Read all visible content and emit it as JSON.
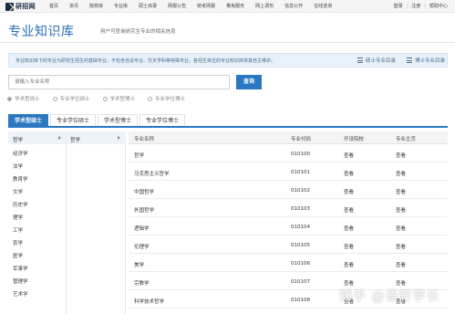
{
  "header": {
    "logo_text": "研招网",
    "nav": [
      "首页",
      "资讯",
      "院校库",
      "专业库",
      "硕士目录",
      "网报公告",
      "统考网报",
      "推免服务",
      "网上调剂",
      "信息公开",
      "在线咨询"
    ],
    "login": "登录",
    "register": "注册",
    "help": "帮助中心"
  },
  "page": {
    "title": "专业知识库",
    "subtitle": "用户可查询研究生专业的相关信息"
  },
  "info": {
    "text": "专业知识库下的专业为研究生招生的基础专业，不包含自设专业、交叉学科等特殊专业，各招生单位的专业知识库将其自主维护。",
    "link_master": "硕士专业目录",
    "link_doctor": "博士专业目录"
  },
  "search": {
    "placeholder": "请输入专业名称",
    "button": "查询"
  },
  "radios": [
    {
      "label": "学术型硕士",
      "checked": true
    },
    {
      "label": "专业学位硕士",
      "checked": false
    },
    {
      "label": "学术型博士",
      "checked": false
    },
    {
      "label": "专业学位博士",
      "checked": false
    }
  ],
  "tabs": [
    "学术型硕士",
    "专业学位硕士",
    "学术型博士",
    "专业学位博士"
  ],
  "categories": [
    "哲学",
    "经济学",
    "法学",
    "教育学",
    "文学",
    "历史学",
    "理学",
    "工学",
    "农学",
    "医学",
    "军事学",
    "管理学",
    "艺术学"
  ],
  "subcategory": "哲学",
  "table": {
    "headers": [
      "专业名称",
      "专业代码",
      "开设院校",
      "专业主页"
    ],
    "rows": [
      {
        "name": "哲学",
        "code": "010100",
        "school": "查看",
        "home": "查看"
      },
      {
        "name": "马克思主义哲学",
        "code": "010101",
        "school": "查看",
        "home": "查看"
      },
      {
        "name": "中国哲学",
        "code": "010102",
        "school": "查看",
        "home": "查看"
      },
      {
        "name": "外国哲学",
        "code": "010103",
        "school": "查看",
        "home": "查看"
      },
      {
        "name": "逻辑学",
        "code": "010104",
        "school": "查看",
        "home": "查看"
      },
      {
        "name": "伦理学",
        "code": "010105",
        "school": "查看",
        "home": "查看"
      },
      {
        "name": "美学",
        "code": "010106",
        "school": "查看",
        "home": "查看"
      },
      {
        "name": "宗教学",
        "code": "010107",
        "school": "查看",
        "home": "查看"
      },
      {
        "name": "科学技术哲学",
        "code": "010108",
        "school": "查看",
        "home": "查看"
      }
    ]
  },
  "watermark": "知乎 @语轩学长",
  "colors": {
    "accent": "#2b78c2",
    "title": "#2a6fb3",
    "info_bg": "#e8f1f9"
  }
}
